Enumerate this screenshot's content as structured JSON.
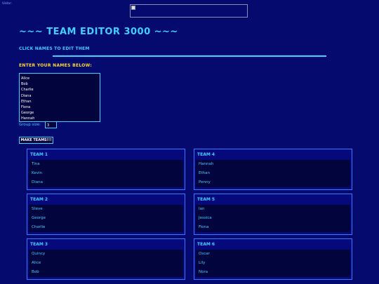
{
  "header": {
    "visitor_label": "Visitor:",
    "title": "~~~ TEAM EDITOR 3000 ~~~",
    "subtitle": "CLICK NAMES TO EDIT THEM"
  },
  "form": {
    "names_label": "ENTER YOUR NAMES BELOW:",
    "names": [
      "Alice",
      "Bob",
      "Charlie",
      "Diana",
      "Ethan",
      "Fiona",
      "George",
      "Hannah"
    ],
    "group_size_label": "Group size:",
    "group_size_value": "3",
    "make_button": "MAKE TEAMS!!!"
  },
  "teams": [
    {
      "title": "TEAM 1",
      "members": [
        "Tina",
        "Kevin",
        "Diana"
      ]
    },
    {
      "title": "TEAM 4",
      "members": [
        "Hannah",
        "Ethan",
        "Penny"
      ]
    },
    {
      "title": "TEAM 2",
      "members": [
        "Steve",
        "George",
        "Charlie"
      ]
    },
    {
      "title": "TEAM 5",
      "members": [
        "Ian",
        "Jessica",
        "Fiona"
      ]
    },
    {
      "title": "TEAM 3",
      "members": [
        "Quincy",
        "Alice",
        "Bob"
      ]
    },
    {
      "title": "TEAM 6",
      "members": [
        "Oscar",
        "Lily",
        "Nora"
      ]
    }
  ]
}
